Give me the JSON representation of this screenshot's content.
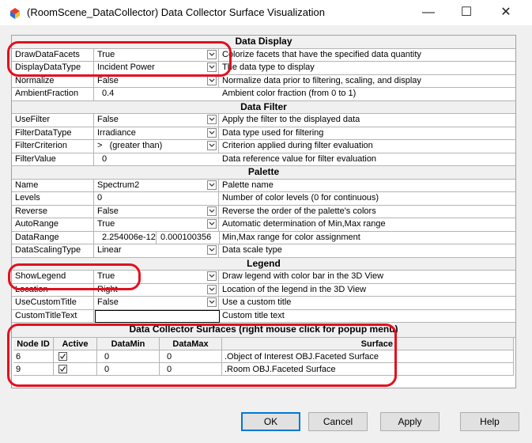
{
  "window": {
    "title": "(RoomScene_DataCollector) Data Collector Surface Visualization",
    "minimize_glyph": "—",
    "maximize_glyph": "☐",
    "close_glyph": "✕",
    "icon": "app-icon"
  },
  "sections": {
    "data_display": "Data Display",
    "data_filter": "Data Filter",
    "palette": "Palette",
    "legend": "Legend",
    "surfaces": "Data Collector Surfaces  (right mouse click for popup menu)"
  },
  "props": {
    "draw_data_facets": {
      "name": "DrawDataFacets",
      "value": "True",
      "desc": "Colorize facets that have the specified data quantity"
    },
    "display_data_type": {
      "name": "DisplayDataType",
      "value": "Incident Power",
      "desc": "The data type to display"
    },
    "normalize": {
      "name": "Normalize",
      "value": "False",
      "desc": "Normalize data prior to filtering, scaling, and display"
    },
    "ambient_fraction": {
      "name": "AmbientFraction",
      "value": "0.4",
      "desc": "Ambient color fraction (from 0 to 1)"
    },
    "use_filter": {
      "name": "UseFilter",
      "value": "False",
      "desc": "Apply the filter to the displayed data"
    },
    "filter_data_type": {
      "name": "FilterDataType",
      "value": "Irradiance",
      "desc": "Data type used for filtering"
    },
    "filter_criterion": {
      "name": "FilterCriterion",
      "value": ">   (greater than)",
      "desc": "Criterion applied during filter evaluation"
    },
    "filter_value": {
      "name": "FilterValue",
      "value": "0",
      "desc": "Data reference value for filter evaluation"
    },
    "palette_name": {
      "name": "Name",
      "value": "Spectrum2",
      "desc": "Palette name"
    },
    "levels": {
      "name": "Levels",
      "value": "0",
      "desc": "Number of color levels (0 for continuous)"
    },
    "reverse": {
      "name": "Reverse",
      "value": "False",
      "desc": "Reverse the order of the palette's colors"
    },
    "auto_range": {
      "name": "AutoRange",
      "value": "True",
      "desc": "Automatic determination of Min,Max range"
    },
    "data_range": {
      "name": "DataRange",
      "min": "2.254006e-12",
      "max": "0.000100356",
      "desc": "Min,Max range for color assignment"
    },
    "data_scaling_type": {
      "name": "DataScalingType",
      "value": "Linear",
      "desc": "Data scale type"
    },
    "show_legend": {
      "name": "ShowLegend",
      "value": "True",
      "desc": "Draw legend with color bar in the 3D View"
    },
    "location": {
      "name": "Location",
      "value": "Right",
      "desc": "Location of the legend in the 3D View"
    },
    "use_custom_title": {
      "name": "UseCustomTitle",
      "value": "False",
      "desc": "Use a custom title"
    },
    "custom_title_text": {
      "name": "CustomTitleText",
      "value": "",
      "desc": "Custom title text"
    }
  },
  "surfaces_table": {
    "headers": {
      "node_id": "Node ID",
      "active": "Active",
      "data_min": "DataMin",
      "data_max": "DataMax",
      "surface": "Surface"
    },
    "rows": [
      {
        "node_id": "6",
        "active": true,
        "data_min": "0",
        "data_max": "0",
        "surface": ".Object of Interest OBJ.Faceted Surface"
      },
      {
        "node_id": "9",
        "active": true,
        "data_min": "0",
        "data_max": "0",
        "surface": ".Room OBJ.Faceted Surface"
      }
    ]
  },
  "buttons": {
    "ok": "OK",
    "cancel": "Cancel",
    "apply": "Apply",
    "help": "Help"
  },
  "colors": {
    "highlight": "#e3101f",
    "default_button_border": "#0078d7"
  }
}
